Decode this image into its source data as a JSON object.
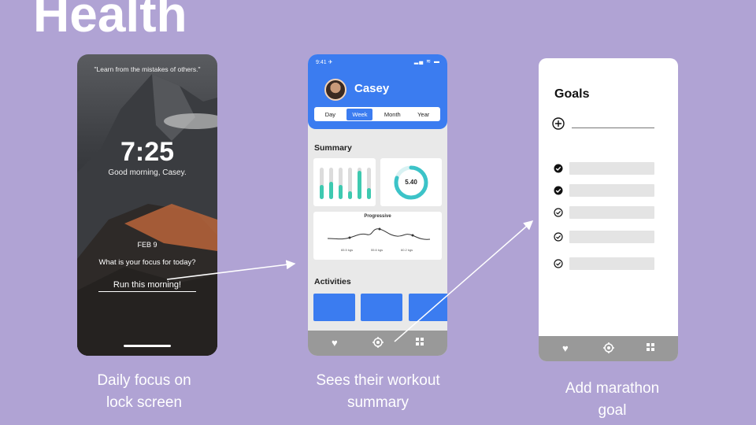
{
  "slide": {
    "title": "Health"
  },
  "captions": {
    "lock": [
      "Daily focus on",
      "lock screen"
    ],
    "summary": [
      "Sees their workout",
      "summary"
    ],
    "goal": [
      "Add marathon",
      "goal"
    ]
  },
  "lock_screen": {
    "quote": "\"Learn from the mistakes of others.\"",
    "time": "7:25",
    "greeting": "Good morning, Casey.",
    "date": "FEB 9",
    "prompt": "What is your focus for today?",
    "focus_input_value": "Run this morning!"
  },
  "summary_screen": {
    "status_time": "9:41 ✈",
    "status_icons": "▂▄ ≋ ▬",
    "user_name": "Casey",
    "tabs": [
      {
        "label": "Day",
        "active": false
      },
      {
        "label": "Week",
        "active": true
      },
      {
        "label": "Month",
        "active": false
      },
      {
        "label": "Year",
        "active": false
      }
    ],
    "summary_title": "Summary",
    "bar_levels": [
      0.45,
      0.55,
      0.45,
      0.25,
      0.9,
      0.35
    ],
    "ring_value": "5.40",
    "ring_progress": 0.8,
    "progress_card": {
      "title": "Progressive",
      "labels": [
        "65.5 kgs",
        "55.6 kgs",
        "60.2 kgs"
      ]
    },
    "activities_title": "Activities",
    "tab_bar": [
      "heart-icon",
      "target-icon",
      "grid-icon"
    ]
  },
  "goals_screen": {
    "title": "Goals",
    "goals": [
      {
        "state": "filled"
      },
      {
        "state": "filled"
      },
      {
        "state": "outline"
      },
      {
        "state": "outline"
      },
      {
        "state": "outline"
      }
    ],
    "tab_bar": [
      "heart-icon",
      "target-icon",
      "grid-icon"
    ]
  },
  "colors": {
    "background": "#b0a3d4",
    "accent": "#3b7cf0",
    "ring": "#3cc3c8",
    "bars": "#3ec9b0",
    "tabbar": "#999999"
  }
}
